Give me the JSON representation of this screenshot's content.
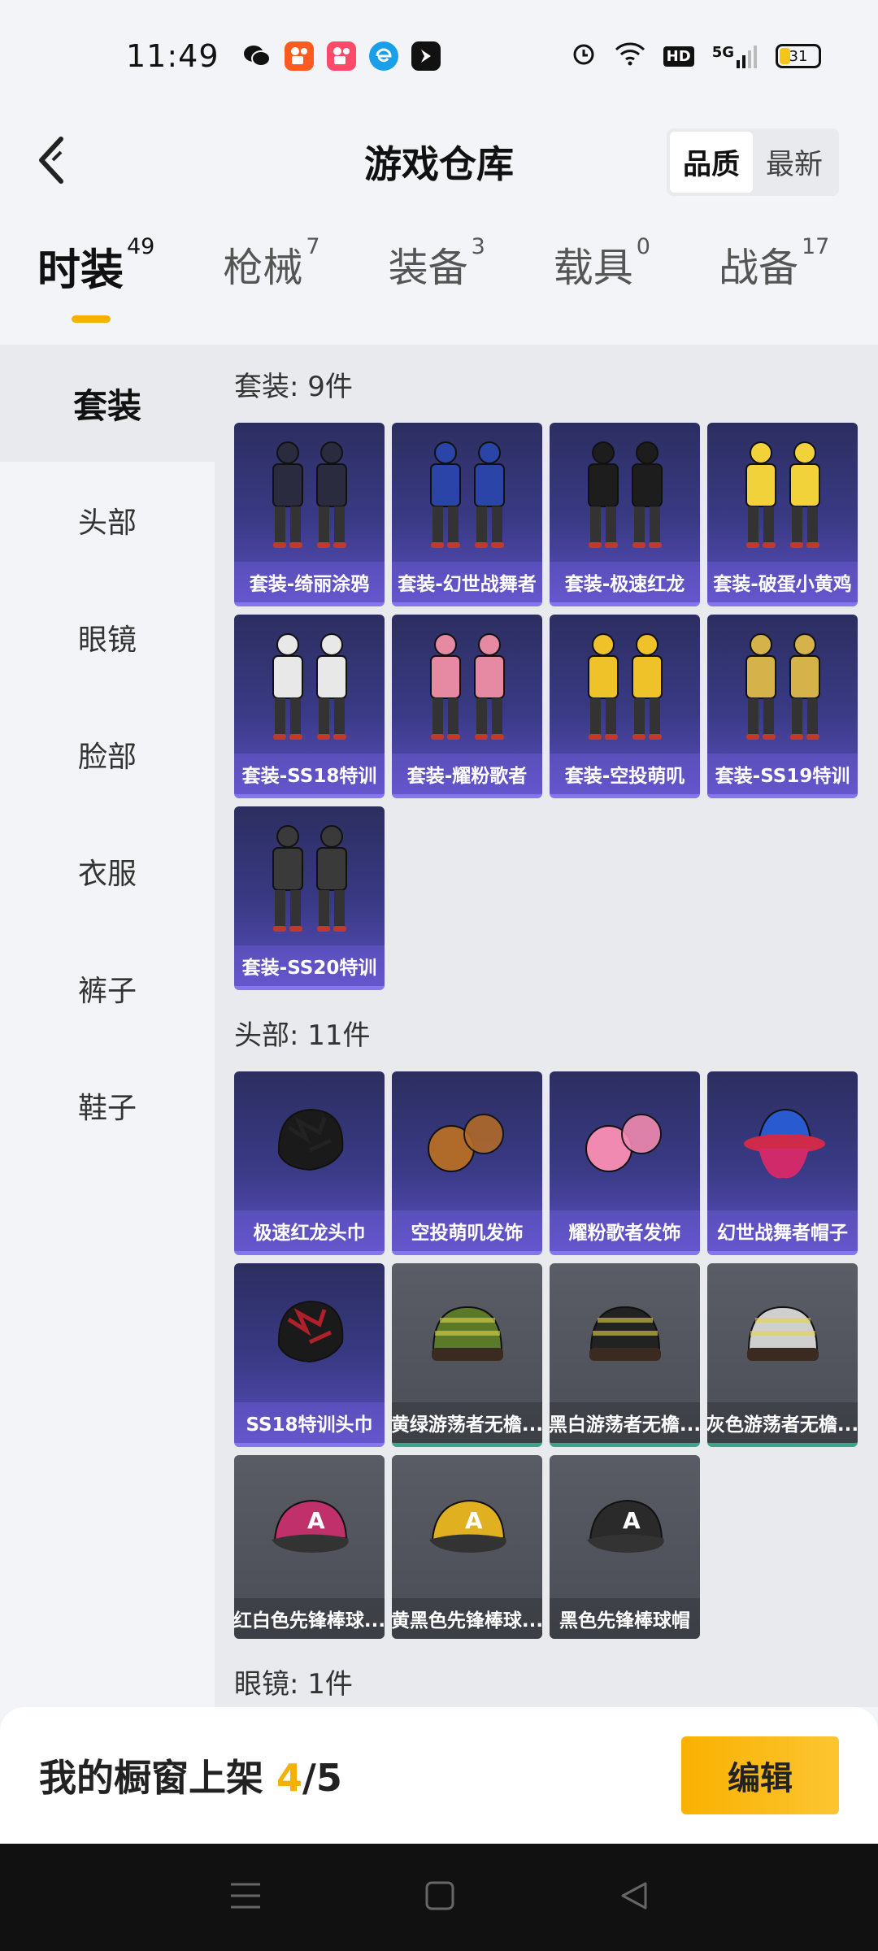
{
  "status_bar": {
    "time": "11:49",
    "network": "5G",
    "battery": "31",
    "notification_icons": [
      "wechat-icon",
      "kuaishou-icon",
      "kuaishou-icon",
      "browser-icon",
      "app-icon"
    ]
  },
  "header": {
    "title": "游戏仓库",
    "sort_options": [
      "品质",
      "最新"
    ],
    "active_sort": "品质"
  },
  "tabs": [
    {
      "label": "时装",
      "count": "49",
      "active": true
    },
    {
      "label": "枪械",
      "count": "7"
    },
    {
      "label": "装备",
      "count": "3"
    },
    {
      "label": "载具",
      "count": "0"
    },
    {
      "label": "战备",
      "count": "17"
    }
  ],
  "sidebar": {
    "items": [
      {
        "label": "套装",
        "active": true
      },
      {
        "label": "头部"
      },
      {
        "label": "眼镜"
      },
      {
        "label": "脸部"
      },
      {
        "label": "衣服"
      },
      {
        "label": "裤子"
      },
      {
        "label": "鞋子"
      }
    ]
  },
  "sections": [
    {
      "title": "套装: 9件",
      "items": [
        {
          "label": "套装-绮丽涂鸦",
          "icon": "outfit-icon",
          "color": "#2b2b40"
        },
        {
          "label": "套装-幻世战舞者",
          "icon": "outfit-icon",
          "color": "#2a44a8"
        },
        {
          "label": "套装-极速红龙",
          "icon": "outfit-icon",
          "color": "#1d1d1d"
        },
        {
          "label": "套装-破蛋小黄鸡",
          "icon": "outfit-icon",
          "color": "#f2d23a"
        },
        {
          "label": "套装-SS18特训",
          "icon": "outfit-icon",
          "color": "#e8e8e8"
        },
        {
          "label": "套装-耀粉歌者",
          "icon": "outfit-icon",
          "color": "#e68aa3"
        },
        {
          "label": "套装-空投萌叽",
          "icon": "outfit-icon",
          "color": "#f0c22a"
        },
        {
          "label": "套装-SS19特训",
          "icon": "outfit-icon",
          "color": "#d6b24a"
        },
        {
          "label": "套装-SS20特训",
          "icon": "outfit-icon",
          "color": "#3a3a3a"
        }
      ]
    },
    {
      "title": "头部: 11件",
      "items": [
        {
          "label": "极速红龙头巾",
          "icon": "helmet-icon",
          "color": "#222222",
          "style": "purple"
        },
        {
          "label": "空投萌叽发饰",
          "icon": "hair-icon",
          "color": "#b06a2a",
          "style": "purple"
        },
        {
          "label": "耀粉歌者发饰",
          "icon": "hair-icon",
          "color": "#f08ab0",
          "style": "purple"
        },
        {
          "label": "幻世战舞者帽子",
          "icon": "hat-icon",
          "color": "#d02a6a",
          "style": "purple"
        },
        {
          "label": "SS18特训头巾",
          "icon": "bandana-icon",
          "color": "#b0202a",
          "style": "purple"
        },
        {
          "label": "黄绿游荡者无檐...",
          "icon": "beanie-icon",
          "color": "#5a7a2a",
          "style": "grey"
        },
        {
          "label": "黑白游荡者无檐...",
          "icon": "beanie-icon",
          "color": "#222222",
          "style": "grey"
        },
        {
          "label": "灰色游荡者无檐...",
          "icon": "beanie-icon",
          "color": "#cfcfcf",
          "style": "grey"
        },
        {
          "label": "红白色先锋棒球...",
          "icon": "cap-icon",
          "color": "#c0306a",
          "style": "plain"
        },
        {
          "label": "黄黑色先锋棒球...",
          "icon": "cap-icon",
          "color": "#e0b020",
          "style": "plain"
        },
        {
          "label": "黑色先锋棒球帽",
          "icon": "cap-icon",
          "color": "#2a2a2a",
          "style": "plain"
        }
      ]
    },
    {
      "title": "眼镜: 1件",
      "items": []
    }
  ],
  "showcase": {
    "text": "我的橱窗上架 ",
    "current": "4",
    "separator": "/",
    "total": "5",
    "edit_label": "编辑"
  },
  "nav": {
    "icons": [
      "menu-icon",
      "home-icon",
      "back-icon"
    ]
  }
}
